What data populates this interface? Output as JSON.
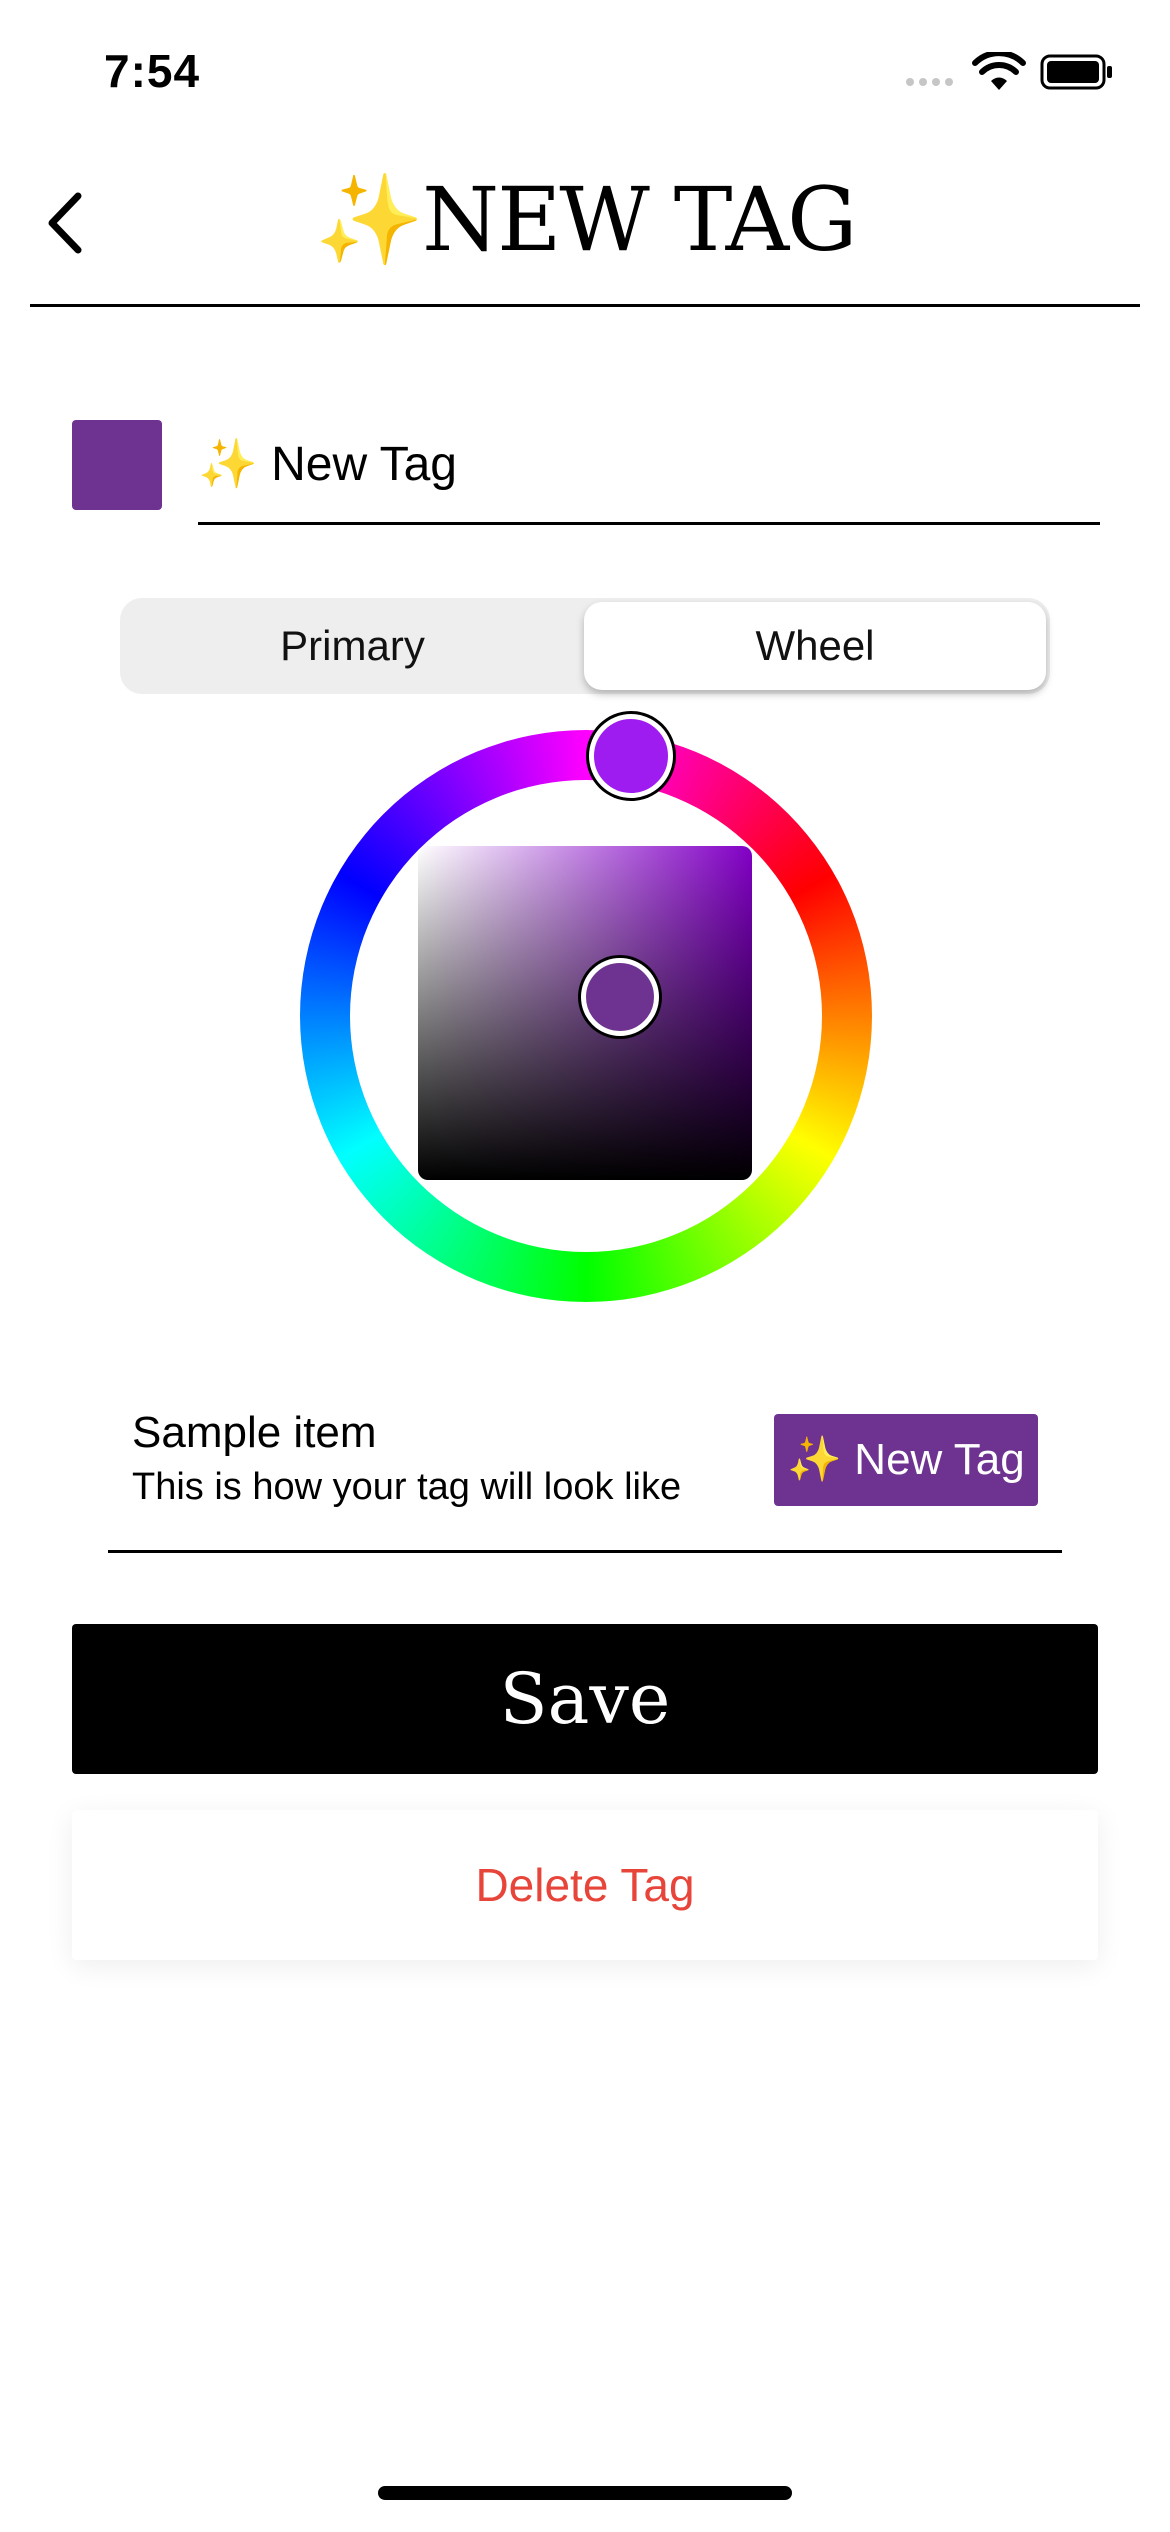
{
  "status_bar": {
    "time": "7:54"
  },
  "header": {
    "title": "✨NEW TAG"
  },
  "tag": {
    "name_value": "✨ New Tag",
    "color": "#6E3391"
  },
  "color_mode": {
    "options": [
      "Primary",
      "Wheel"
    ],
    "selected": "Wheel"
  },
  "picker": {
    "hue_color": "#9F1CF0",
    "selected_color": "#6E3391"
  },
  "sample": {
    "title": "Sample item",
    "subtitle": "This is how your tag will look like",
    "badge_label": "✨ New Tag"
  },
  "actions": {
    "save_label": "Save",
    "delete_label": "Delete Tag",
    "delete_color": "#E8453A"
  },
  "icons": {
    "back": "chevron-left-icon",
    "wifi": "wifi-icon",
    "battery": "battery-icon",
    "signal": "signal-dots-icon"
  }
}
